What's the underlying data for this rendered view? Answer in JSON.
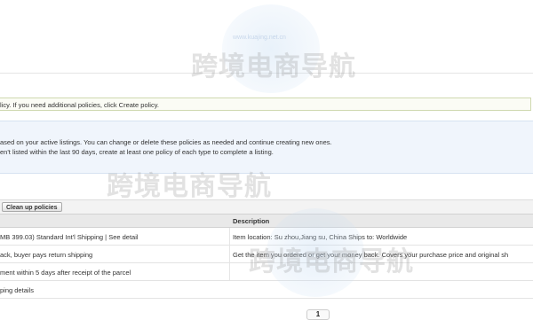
{
  "notice": {
    "text": "licy. If you need additional policies, click Create policy."
  },
  "info": {
    "line1": "ased on your active listings. You can change or delete these policies as needed and continue creating new ones.",
    "line2": "en't listed within the last 90 days, create at least one policy of each type to complete a listing."
  },
  "toolbar": {
    "cleanup_label": "Clean up policies"
  },
  "table": {
    "header_description": "Description",
    "rows": [
      {
        "name": "MB 399.03) Standard Int'l Shipping | See detail",
        "description": "Item location: Su zhou,Jiang su, China Ships to: Worldwide"
      },
      {
        "name": "ack, buyer pays return shipping",
        "description": "Get the item you ordered or get your money back. Covers your purchase price and original sh"
      },
      {
        "name": "ment within 5 days after receipt of the parcel",
        "description": ""
      },
      {
        "name": "ping details",
        "description": ""
      }
    ]
  },
  "pager": {
    "current_page": "1"
  },
  "watermark": {
    "text": "跨境电商导航",
    "sub": "www.kuajing.net.cn"
  }
}
